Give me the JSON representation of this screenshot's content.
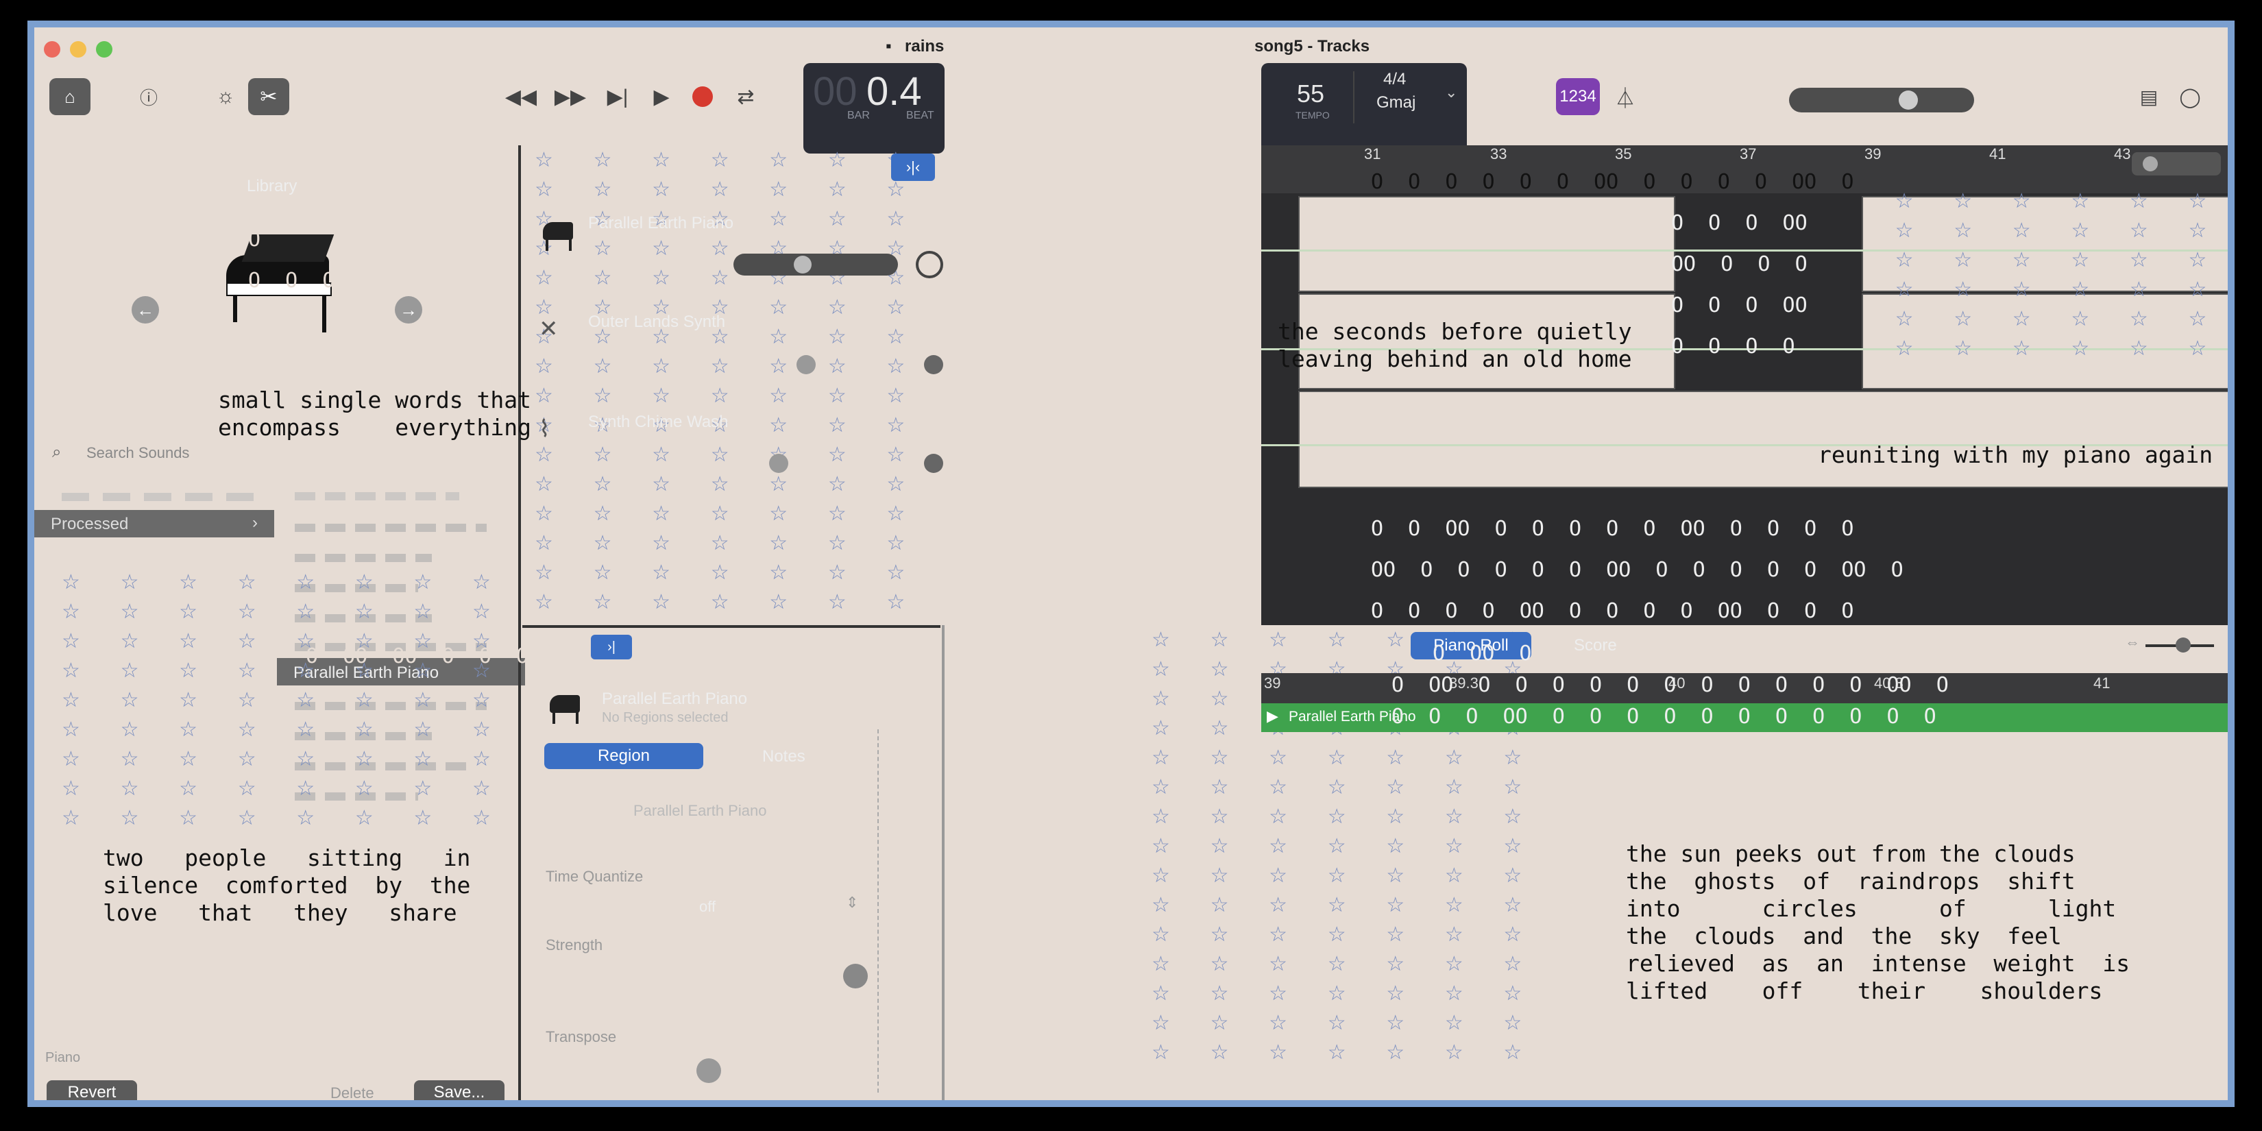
{
  "window": {
    "title_left": "rains",
    "title_right": "song5 - Tracks"
  },
  "toolbar": {
    "lcd_bar_prefix": "00",
    "lcd_value": "0.4",
    "lcd_bar_label": "BAR",
    "lcd_beat_label": "BEAT",
    "tempo": "55",
    "tempo_label": "TEMPO",
    "time_signature": "4/4",
    "key": "Gmaj",
    "count_in": "1234"
  },
  "library": {
    "title": "Library",
    "search_placeholder": "Search Sounds",
    "selected_category": "Processed",
    "selected_patch": "Parallel Earth Piano",
    "footer_path": "Piano",
    "revert": "Revert",
    "delete": "Delete",
    "save": "Save..."
  },
  "tracks": [
    {
      "name": "Parallel Earth Piano"
    },
    {
      "name": "Outer Lands Synth"
    },
    {
      "name": "Synth Chime Wash"
    }
  ],
  "inspector": {
    "track_name": "Parallel Earth Piano",
    "regions_selected": "No Regions selected",
    "tab_region": "Region",
    "tab_notes": "Notes",
    "region_name": "Parallel Earth Piano",
    "time_quantize_label": "Time Quantize",
    "time_quantize_value": "off",
    "strength_label": "Strength",
    "transpose_label": "Transpose"
  },
  "ruler": {
    "bars": [
      "31",
      "33",
      "35",
      "37",
      "39",
      "41",
      "43"
    ]
  },
  "regions": [
    {
      "name": "Outer Lands Synth"
    },
    {
      "name": "Parallel Earth Piano"
    },
    {
      "name": "Outer Lands Synth"
    },
    {
      "name": "Parallel Earth Piano"
    },
    {
      "name": "Synth Chime Wash"
    },
    {
      "name": "Synth Chime Wash"
    }
  ],
  "editor": {
    "tab_piano_roll": "Piano Roll",
    "tab_score": "Score",
    "ruler": [
      "39",
      "39.3",
      "40",
      "40.3",
      "41"
    ],
    "region_label": "Parallel Earth Piano"
  },
  "poems": {
    "p1": "small single words that\nencompass    everything",
    "p2": "two   people   sitting   in\nsilence  comforted  by  the\nlove   that   they   share",
    "p3": "the seconds before quietly\nleaving behind an old home",
    "p4": "reuniting with my piano again",
    "p5": "the sun peeks out from the clouds\nthe  ghosts  of  raindrops  shift\ninto      circles      of      light\nthe  clouds  and  the  sky  feel\nrelieved  as  an  intense  weight  is\nlifted    off    their    shoulders"
  },
  "colors": {
    "background": "#e6dcd4",
    "frame": "#7b9fcf",
    "star": "#7b8fc0",
    "accent_blue": "#3b6fc4",
    "region_green": "#3fa34d",
    "record_red": "#d63a2f",
    "count_in_purple": "#7e3fb0"
  }
}
